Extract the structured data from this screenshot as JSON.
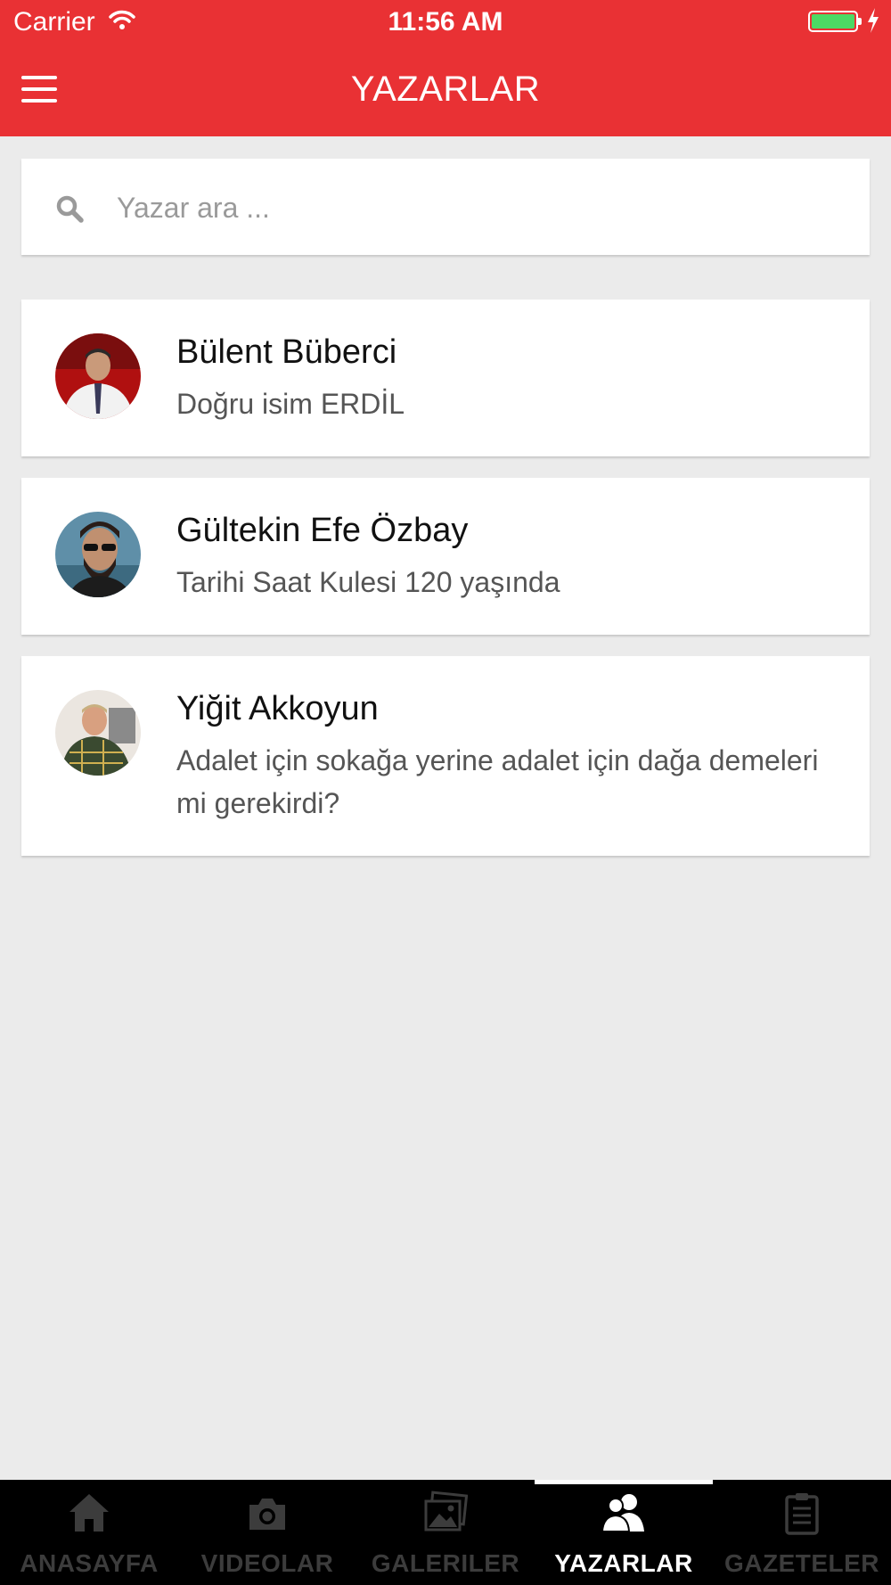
{
  "status_bar": {
    "carrier": "Carrier",
    "time": "11:56 AM"
  },
  "header": {
    "title": "YAZARLAR",
    "menu_icon": "hamburger-icon"
  },
  "search": {
    "placeholder": "Yazar ara ...",
    "value": "",
    "icon": "search-icon"
  },
  "authors": [
    {
      "name": "Bülent Büberci",
      "article": "Doğru isim ERDİL"
    },
    {
      "name": "Gültekin Efe Özbay",
      "article": "Tarihi Saat Kulesi 120 yaşında"
    },
    {
      "name": "Yiğit Akkoyun",
      "article": "Adalet için sokağa yerine adalet için dağa demeleri mi gerekirdi?"
    }
  ],
  "tabs": [
    {
      "label": "ANASAYFA",
      "icon": "home-icon"
    },
    {
      "label": "VIDEOLAR",
      "icon": "camera-icon"
    },
    {
      "label": "GALERILER",
      "icon": "gallery-icon"
    },
    {
      "label": "YAZARLAR",
      "icon": "authors-icon",
      "active": true
    },
    {
      "label": "GAZETELER",
      "icon": "clipboard-icon"
    }
  ],
  "colors": {
    "header_bg": "#e93134",
    "background": "#ebebeb",
    "tabbar_bg": "#000000",
    "tab_inactive": "#3c3c3c",
    "tab_active": "#ffffff"
  }
}
